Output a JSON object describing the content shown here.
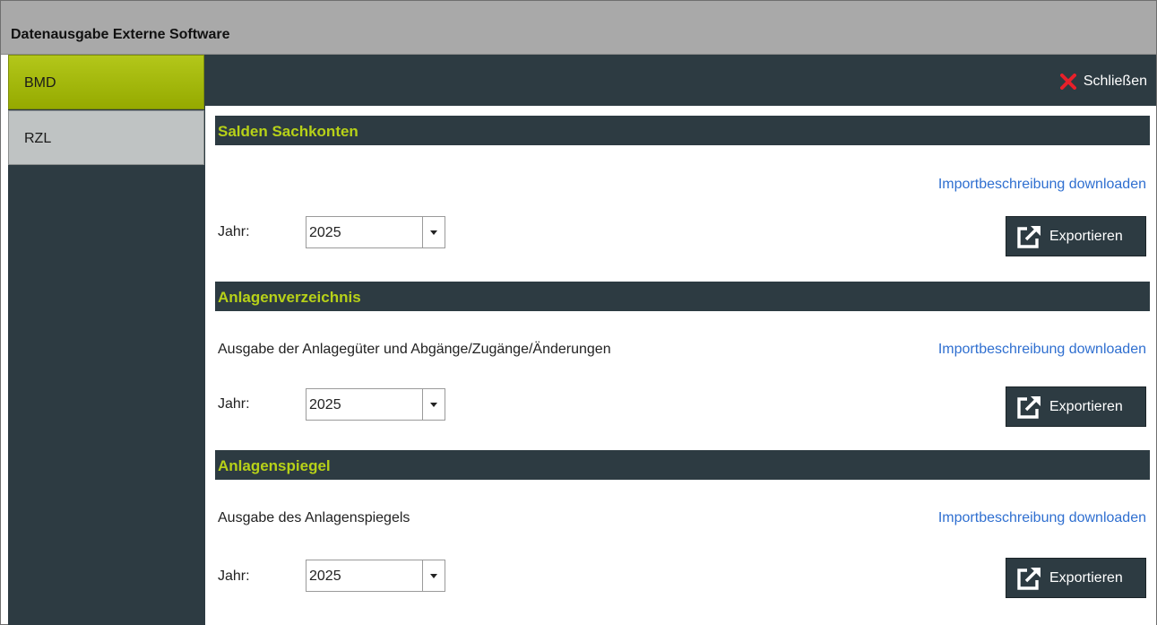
{
  "window": {
    "title": "Datenausgabe Externe Software"
  },
  "sidebar": {
    "items": [
      {
        "label": "BMD",
        "active": true
      },
      {
        "label": "RZL",
        "active": false
      }
    ]
  },
  "toolbar": {
    "close_label": "Schließen",
    "close_icon": "close-x-icon",
    "close_color": "#e8202a"
  },
  "colors": {
    "accent": "#b7d118",
    "dark": "#2d3b42",
    "link": "#2f6fd0"
  },
  "sections": [
    {
      "title": "Salden Sachkonten",
      "description": "",
      "link": "Importbeschreibung downloaden",
      "year_label": "Jahr:",
      "year_value": "2025",
      "export_label": "Exportieren"
    },
    {
      "title": "Anlagenverzeichnis",
      "description": "Ausgabe der Anlagegüter und Abgänge/Zugänge/Änderungen",
      "link": "Importbeschreibung downloaden",
      "year_label": "Jahr:",
      "year_value": "2025",
      "export_label": "Exportieren"
    },
    {
      "title": "Anlagenspiegel",
      "description": "Ausgabe des Anlagenspiegels",
      "link": "Importbeschreibung downloaden",
      "year_label": "Jahr:",
      "year_value": "2025",
      "export_label": "Exportieren"
    }
  ]
}
